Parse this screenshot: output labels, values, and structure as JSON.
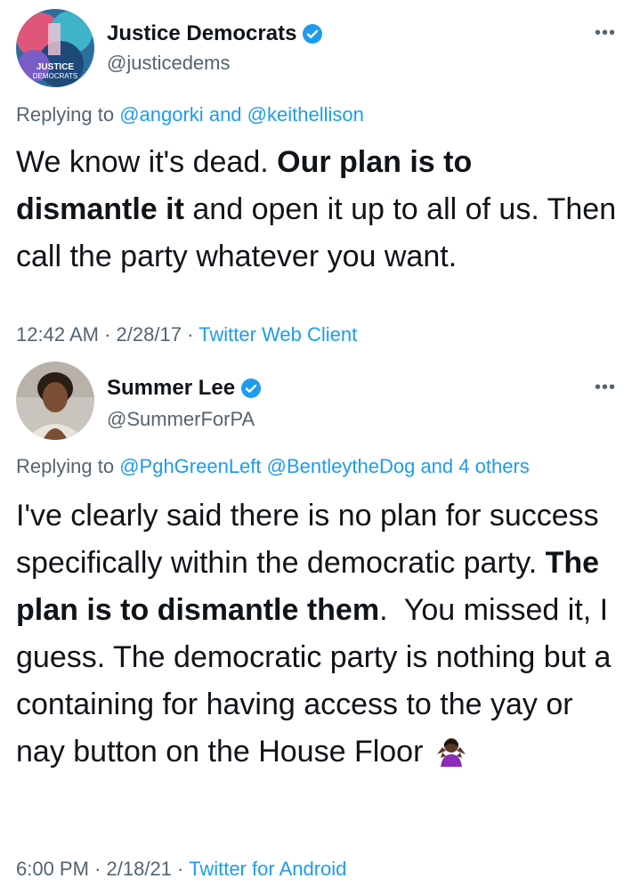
{
  "tweets": [
    {
      "display_name": "Justice Democrats",
      "handle": "@justicedems",
      "avatar_text_line1": "JUSTICE",
      "avatar_text_line2": "DEMOCRATS",
      "replying_prefix": "Replying to",
      "replying_1": "@angorki",
      "replying_sep": "and",
      "replying_2": "@keithellison",
      "text_1": "We know it's dead.",
      "text_bold_1": "Our plan is to dismantle it",
      "text_2": "and open it up to all of us. Then call the party whatever you want.",
      "time": "12:42 AM",
      "date": "2/28/17",
      "client": "Twitter Web Client",
      "dot": "·"
    },
    {
      "display_name": "Summer Lee",
      "handle": "@SummerForPA",
      "replying_prefix": "Replying to",
      "replying_1": "@PghGreenLeft",
      "replying_2": "@BentleytheDog",
      "replying_sep": "and",
      "replying_others": "4 others",
      "text_1": "I've clearly said there is no plan for success specifically within the democratic party.",
      "text_bold_1": "The plan is to dismantle them",
      "text_2": ".  You missed it, I guess. The democratic party is nothing but a containing for having access to the yay or nay button on the House Floor",
      "time": "6:00 PM",
      "date": "2/18/21",
      "client": "Twitter for Android",
      "dot": "·"
    }
  ],
  "icons": {
    "verified": "verified-badge-icon",
    "more": "more-options-icon",
    "shrug": "woman-shrugging-emoji"
  },
  "colors": {
    "link": "#1d9bf0",
    "secondary": "#536471",
    "text": "#0f1419"
  }
}
